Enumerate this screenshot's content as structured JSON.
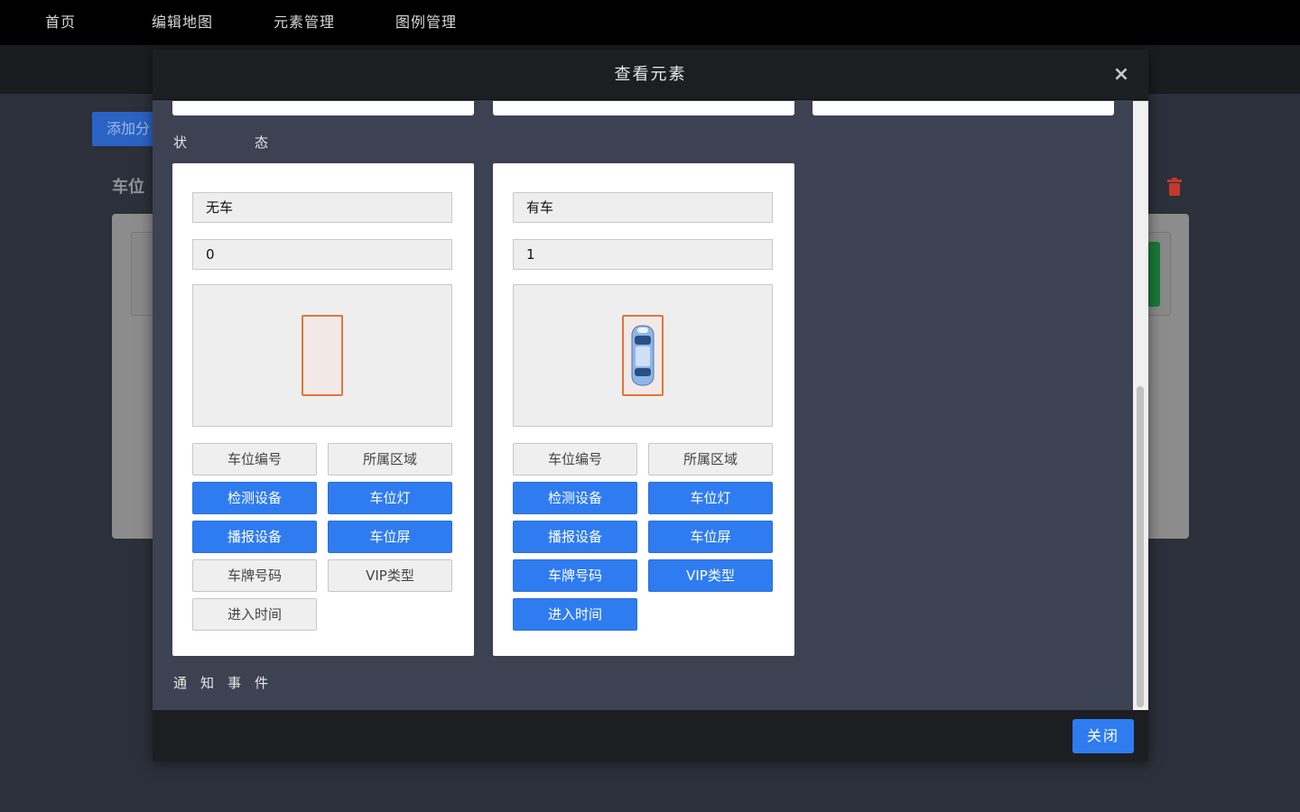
{
  "nav": {
    "items": [
      "首页",
      "编辑地图",
      "元素管理",
      "图例管理"
    ]
  },
  "background": {
    "add_button_label": "添加分",
    "section_title": "车位"
  },
  "modal": {
    "title": "查看元素",
    "close_icon": "close-icon",
    "footer_button": "关闭",
    "status_label": "状　　　　　态",
    "notify_label": "通　知　事　件",
    "states": [
      {
        "name": "无车",
        "value": "0",
        "has_car": false,
        "tags": [
          {
            "label": "车位编号",
            "active": false
          },
          {
            "label": "所属区域",
            "active": false
          },
          {
            "label": "检测设备",
            "active": true
          },
          {
            "label": "车位灯",
            "active": true
          },
          {
            "label": "播报设备",
            "active": true
          },
          {
            "label": "车位屏",
            "active": true
          },
          {
            "label": "车牌号码",
            "active": false
          },
          {
            "label": "VIP类型",
            "active": false
          },
          {
            "label": "进入时间",
            "active": false
          }
        ]
      },
      {
        "name": "有车",
        "value": "1",
        "has_car": true,
        "tags": [
          {
            "label": "车位编号",
            "active": false
          },
          {
            "label": "所属区域",
            "active": false
          },
          {
            "label": "检测设备",
            "active": true
          },
          {
            "label": "车位灯",
            "active": true
          },
          {
            "label": "播报设备",
            "active": true
          },
          {
            "label": "车位屏",
            "active": true
          },
          {
            "label": "车牌号码",
            "active": true
          },
          {
            "label": "VIP类型",
            "active": true
          },
          {
            "label": "进入时间",
            "active": true
          }
        ]
      }
    ]
  },
  "colors": {
    "active": "#2f7cf0",
    "slot_border": "#e0763b",
    "modal_bg": "#3c4252"
  }
}
